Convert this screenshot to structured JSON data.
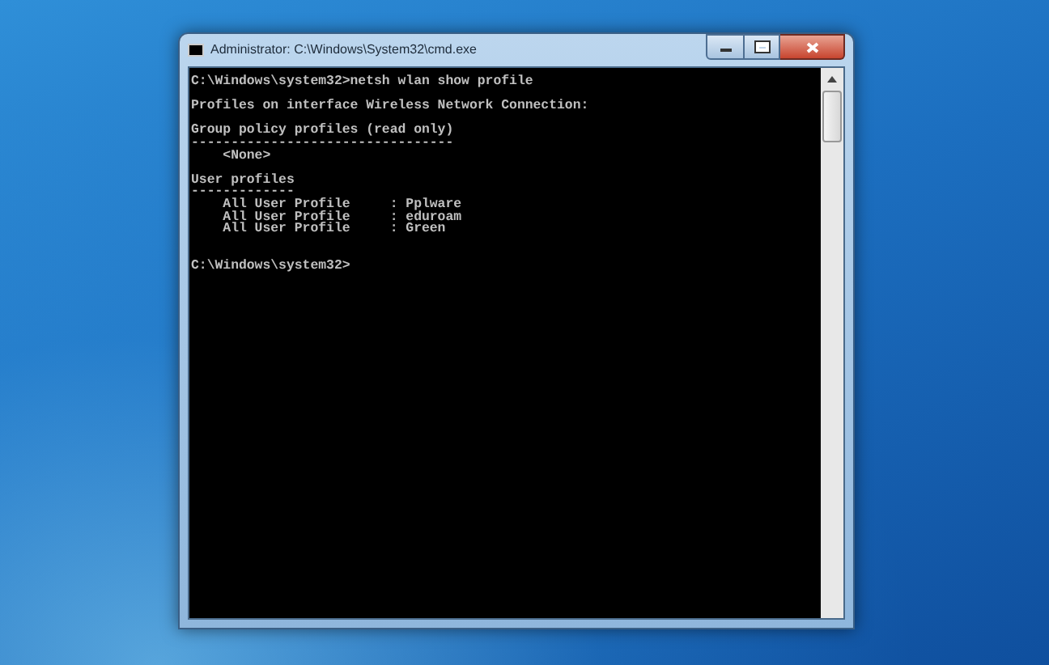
{
  "window": {
    "title": "Administrator: C:\\Windows\\System32\\cmd.exe"
  },
  "console": {
    "lines": [
      {
        "kind": "text",
        "text": "C:\\Windows\\system32>netsh wlan show profile"
      },
      {
        "kind": "blank"
      },
      {
        "kind": "text",
        "text": "Profiles on interface Wireless Network Connection:"
      },
      {
        "kind": "blank"
      },
      {
        "kind": "text",
        "text": "Group policy profiles (read only)"
      },
      {
        "kind": "text",
        "text": "---------------------------------"
      },
      {
        "kind": "text",
        "text": "    <None>"
      },
      {
        "kind": "blank"
      },
      {
        "kind": "text",
        "text": "User profiles"
      },
      {
        "kind": "text",
        "text": "-------------"
      },
      {
        "kind": "text",
        "text": "    All User Profile     : Pplware"
      },
      {
        "kind": "text",
        "text": "    All User Profile     : eduroam"
      },
      {
        "kind": "text",
        "text": "    All User Profile     : Green"
      },
      {
        "kind": "blank"
      },
      {
        "kind": "blank"
      },
      {
        "kind": "text",
        "text": "C:\\Windows\\system32>"
      }
    ]
  }
}
